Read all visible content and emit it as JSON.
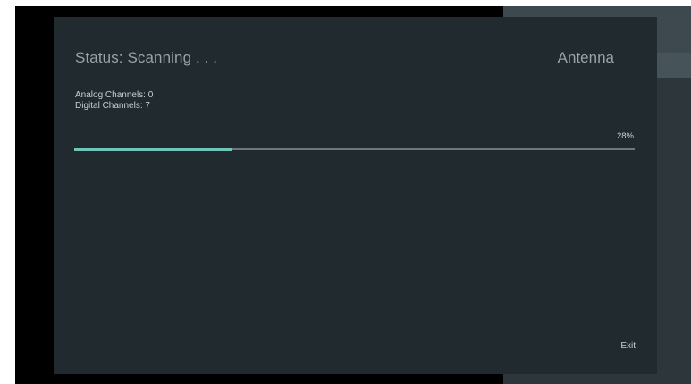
{
  "scan": {
    "status_text": "Status: Scanning . . .",
    "source": "Antenna",
    "analog_channels": "Analog Channels: 0",
    "digital_channels": "Digital Channels: 7",
    "progress_text": "28%",
    "progress_fraction": 0.28
  },
  "actions": {
    "exit_label": "Exit"
  },
  "colors": {
    "dialog_bg": "#202a2f",
    "progress_accent": "#6fc6b8",
    "text_dim": "#9aa3a8",
    "text_light": "#c9d0d3"
  }
}
